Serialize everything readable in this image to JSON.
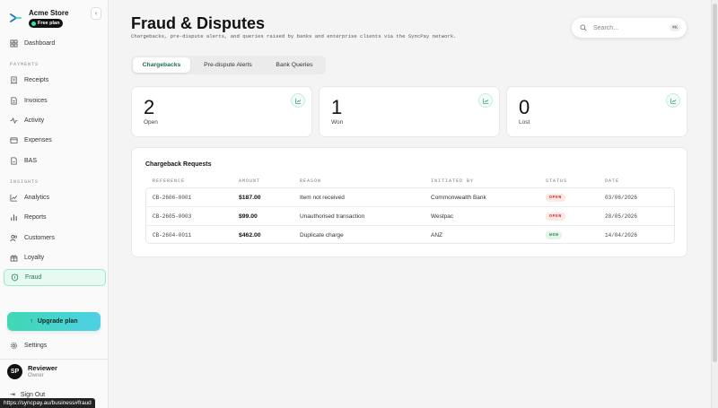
{
  "app": {
    "store_name": "Acme Store",
    "plan": "Free plan",
    "collapse_icon": "chevron-left-icon"
  },
  "sidebar": {
    "sections": [
      {
        "label": "PAYMENTS"
      },
      {
        "label": "INSIGHTS"
      }
    ],
    "items": [
      {
        "label": "Dashboard",
        "icon": "grid-icon"
      },
      {
        "label": "Receipts",
        "icon": "receipt-icon"
      },
      {
        "label": "Invoices",
        "icon": "invoice-icon"
      },
      {
        "label": "Activity",
        "icon": "activity-icon"
      },
      {
        "label": "Expenses",
        "icon": "wallet-icon"
      },
      {
        "label": "BAS",
        "icon": "document-icon"
      },
      {
        "label": "Analytics",
        "icon": "line-chart-icon"
      },
      {
        "label": "Reports",
        "icon": "bar-chart-icon"
      },
      {
        "label": "Customers",
        "icon": "users-icon"
      },
      {
        "label": "Loyalty",
        "icon": "gift-icon"
      },
      {
        "label": "Fraud",
        "icon": "shield-icon",
        "active": true
      }
    ],
    "upgrade_label": "Upgrade plan",
    "settings_label": "Settings",
    "user": {
      "initials": "SP",
      "name": "Reviewer",
      "role": "Owner"
    },
    "signout_label": "Sign Out"
  },
  "status_bar_url": "https://syncpay.au/business#fraud",
  "header": {
    "title": "Fraud & Disputes",
    "subtitle": "Chargebacks, pre-dispute alerts, and queries raised by banks and enterprise clients via the SyncPay network.",
    "search_placeholder": "Search...",
    "search_shortcut": "⌘K"
  },
  "tabs": [
    {
      "label": "Chargebacks",
      "active": true
    },
    {
      "label": "Pre-dispute Alerts"
    },
    {
      "label": "Bank Queries"
    }
  ],
  "stats": [
    {
      "value": "2",
      "label": "Open",
      "icon": "chart-icon"
    },
    {
      "value": "1",
      "label": "Won",
      "icon": "chart-icon"
    },
    {
      "value": "0",
      "label": "Lost",
      "icon": "chart-icon"
    }
  ],
  "table": {
    "title": "Chargeback Requests",
    "columns": [
      "REFERENCE",
      "AMOUNT",
      "REASON",
      "INITIATED BY",
      "STATUS",
      "DATE"
    ],
    "rows": [
      {
        "reference": "CB-2606-0001",
        "amount": "$187.00",
        "reason": "Item not received",
        "initiated_by": "Commonwealth Bank",
        "status": "OPEN",
        "date": "03/06/2026"
      },
      {
        "reference": "CB-2605-0003",
        "amount": "$99.00",
        "reason": "Unauthorised transaction",
        "initiated_by": "Westpac",
        "status": "OPEN",
        "date": "28/05/2026"
      },
      {
        "reference": "CB-2604-0011",
        "amount": "$462.00",
        "reason": "Duplicate charge",
        "initiated_by": "ANZ",
        "status": "WON",
        "date": "14/04/2026"
      }
    ]
  },
  "colors": {
    "accent": "#3fd8b3",
    "active_nav_bg": "#e7faf2",
    "status_open": "#c0392b",
    "status_won": "#2b8a4e"
  }
}
